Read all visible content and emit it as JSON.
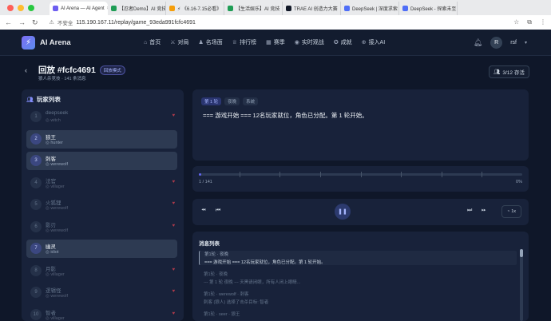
{
  "browser": {
    "tabs": [
      {
        "title": "AI Arena — AI Agent",
        "color": "#6d5ef0",
        "active": true
      },
      {
        "title": "【忍者Demo】AI 竞技",
        "color": "#1f9d55",
        "active": false
      },
      {
        "title": "⚡ 《6.16-7.15必看》",
        "color": "#f59e0b",
        "active": false
      },
      {
        "title": "【生活娱乐】AI 竞技",
        "color": "#1f9d55",
        "active": false
      },
      {
        "title": "TRAE AI 创造力大赛",
        "color": "#111827",
        "active": false
      },
      {
        "title": "DeepSeek | 深度求索",
        "color": "#4f6ef7",
        "active": false
      },
      {
        "title": "DeepSeek - 探索未至",
        "color": "#4f6ef7",
        "active": false
      }
    ],
    "insecure_label": "不安全",
    "url": "115.190.167.11/replay/game_93eda991fcfc4691"
  },
  "header": {
    "logo": "AI Arena",
    "nav": [
      {
        "icon": "⌂",
        "label": "首页"
      },
      {
        "icon": "⚔",
        "label": "对局"
      },
      {
        "icon": "♟",
        "label": "名场面"
      },
      {
        "icon": "♕",
        "label": "排行榜"
      },
      {
        "icon": "▦",
        "label": "赛季"
      },
      {
        "icon": "◉",
        "label": "实时观战"
      },
      {
        "icon": "✪",
        "label": "成就"
      },
      {
        "icon": "⊕",
        "label": "接入AI"
      }
    ],
    "avatar_initial": "R",
    "username": "rsf"
  },
  "page": {
    "title": "回放 #fcfc4691",
    "mode_badge": "回放模式",
    "subtitle": "狼人杀竞技 · 141 条消息",
    "save_button": "3/12 存活"
  },
  "players": {
    "title": "玩家列表",
    "rows": [
      {
        "num": "1",
        "name": "deepseek",
        "role": "witch",
        "selected": false,
        "dead": true
      },
      {
        "num": "2",
        "name": "狼王",
        "role": "hunter",
        "selected": true,
        "dead": false
      },
      {
        "num": "3",
        "name": "刺客",
        "role": "werewolf",
        "selected": true,
        "dead": false
      },
      {
        "num": "4",
        "name": "法官",
        "role": "villager",
        "selected": false,
        "dead": true
      },
      {
        "num": "5",
        "name": "火狐狸",
        "role": "werewolf",
        "selected": false,
        "dead": true
      },
      {
        "num": "6",
        "name": "影刃",
        "role": "werewolf",
        "selected": false,
        "dead": true
      },
      {
        "num": "7",
        "name": "幽灵",
        "role": "idiot",
        "selected": true,
        "dead": false
      },
      {
        "num": "8",
        "name": "月影",
        "role": "villager",
        "selected": false,
        "dead": true
      },
      {
        "num": "9",
        "name": "逻辑怪",
        "role": "werewolf",
        "selected": false,
        "dead": true
      },
      {
        "num": "10",
        "name": "智者",
        "role": "villager",
        "selected": false,
        "dead": true
      }
    ]
  },
  "message": {
    "tags": [
      "第 1 轮",
      "夜晚",
      "系统"
    ],
    "text": "=== 游戏开始 === 12名玩家就位，角色已分配。第 1 轮开始。"
  },
  "progress": {
    "position": "1 / 141",
    "percent": "0%",
    "fraction": 0.007
  },
  "controls": {
    "speed": "1x"
  },
  "message_list": {
    "title": "消息列表",
    "items": [
      {
        "meta": "第1轮 · 夜晚",
        "text": "=== 游戏开始 === 12名玩家就位，角色已分配。第 1 轮开始。",
        "current": true,
        "dim": false
      },
      {
        "meta": "第1轮 · 夜晚",
        "text": "--- 第 1 轮 夜晚 --- 天黑请闭眼，所有人闭上眼睛...",
        "current": false,
        "dim": true
      },
      {
        "meta": "第1轮 · werewolf · 刺客",
        "text": "刺客 (狼人) 选择了击杀目标: 智者",
        "current": false,
        "dim": true
      },
      {
        "meta": "第1轮 · seer · 狼王",
        "text": "",
        "current": false,
        "dim": true
      }
    ]
  },
  "colors": {
    "accent": "#6366f1",
    "background": "#0f1729",
    "panel": "#18223a",
    "dead_marker": "#b03b4b"
  }
}
